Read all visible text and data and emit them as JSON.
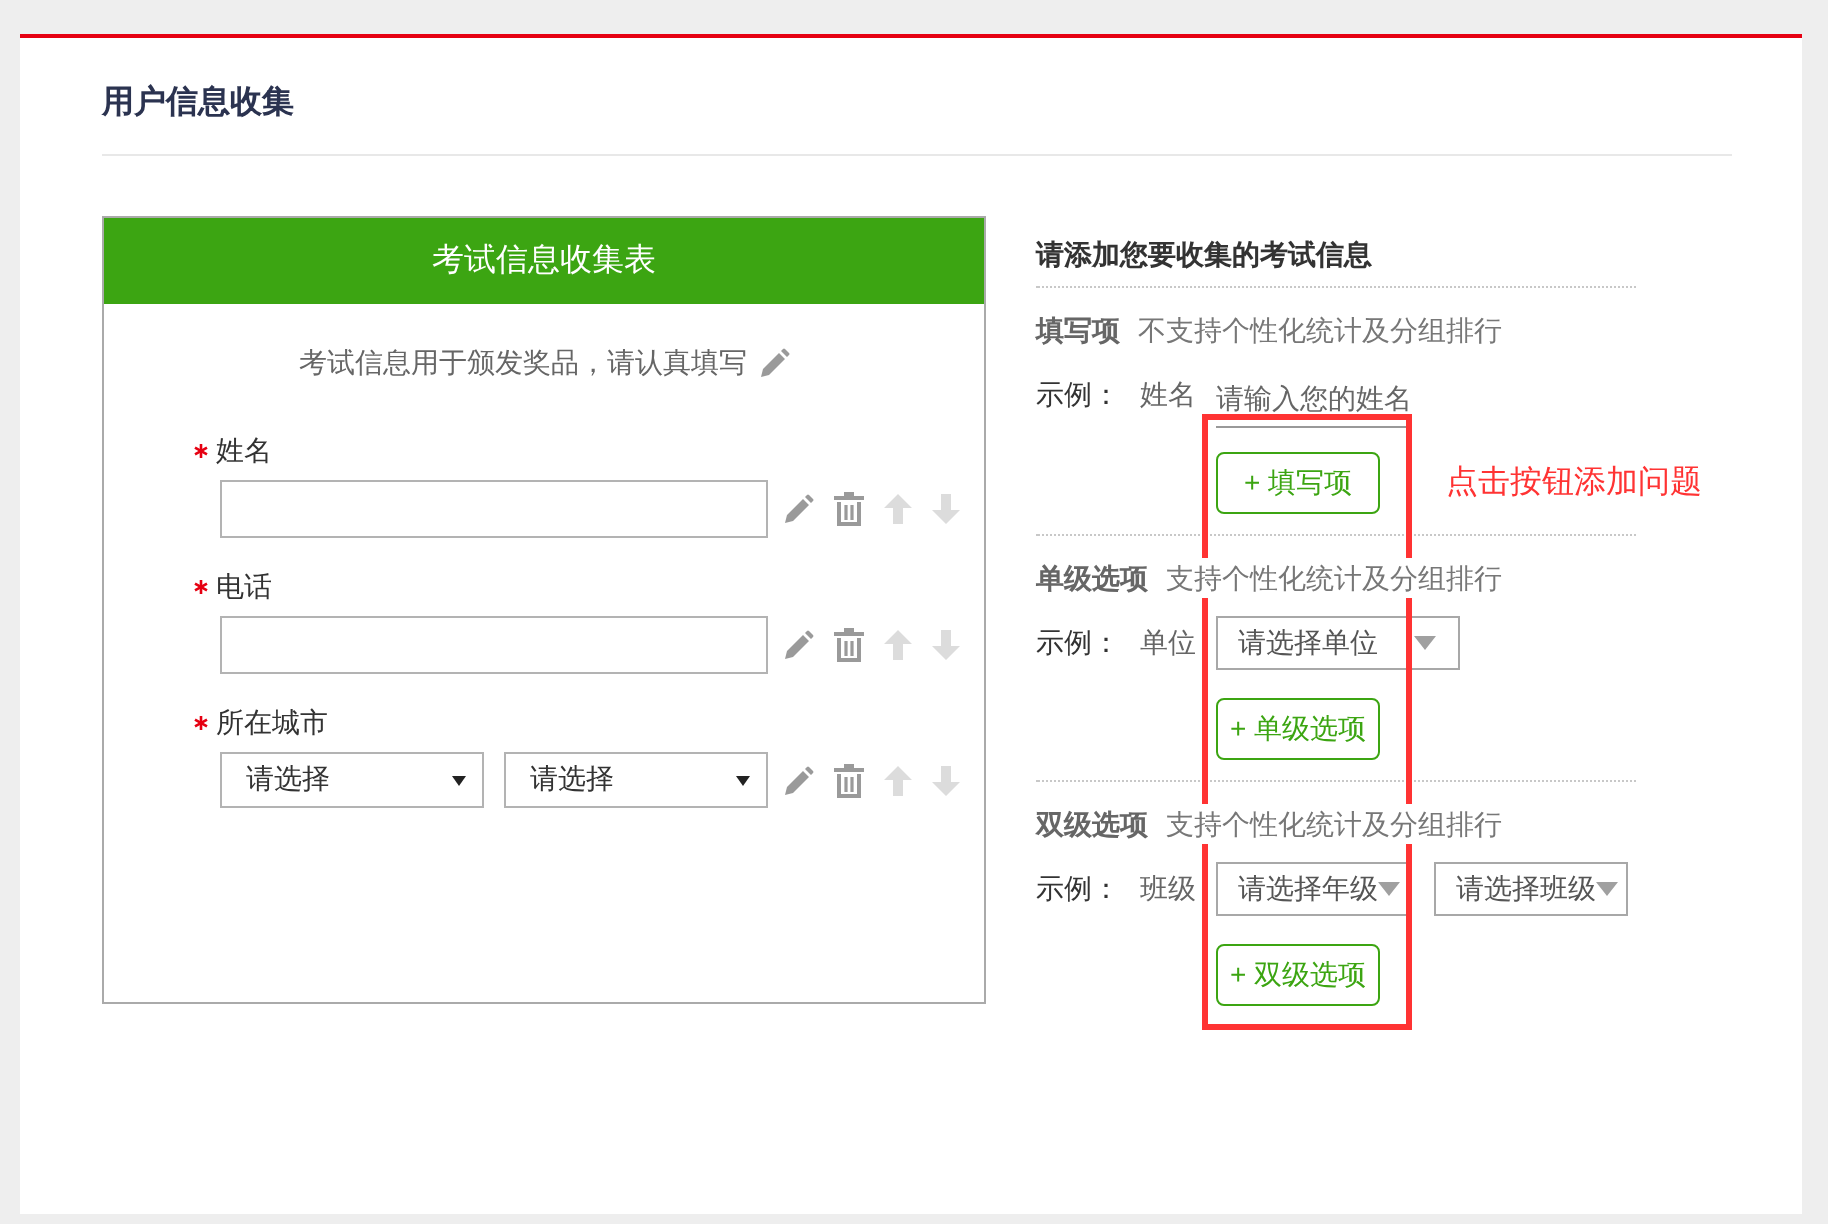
{
  "page": {
    "title": "用户信息收集"
  },
  "form_preview": {
    "title": "考试信息收集表",
    "subtitle": "考试信息用于颁发奖品，请认真填写",
    "fields": [
      {
        "kind": "text",
        "label": "姓名",
        "required": true
      },
      {
        "kind": "text",
        "label": "电话",
        "required": true
      },
      {
        "kind": "select",
        "label": "所在城市",
        "required": true,
        "selects": [
          "请选择",
          "请选择"
        ]
      }
    ]
  },
  "question_types": {
    "heading": "请添加您要收集的考试信息",
    "callout": "点击按钮添加问题",
    "sections": [
      {
        "kind": "text",
        "name": "填写项",
        "description": "不支持个性化统计及分组排行",
        "example_label": "示例：",
        "example_field": "姓名",
        "placeholder": "请输入您的姓名",
        "button": "+ 填写项"
      },
      {
        "kind": "select",
        "name": "单级选项",
        "description": "支持个性化统计及分组排行",
        "example_label": "示例：",
        "example_field": "单位",
        "selects": [
          "请选择单位"
        ],
        "button": "+ 单级选项"
      },
      {
        "kind": "select",
        "name": "双级选项",
        "description": "支持个性化统计及分组排行",
        "example_label": "示例：",
        "example_field": "班级",
        "selects": [
          "请选择年级",
          "请选择班级"
        ],
        "button": "+ 双级选项"
      }
    ]
  }
}
